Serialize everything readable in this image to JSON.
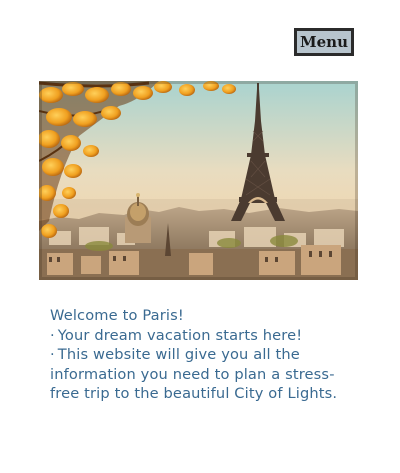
{
  "header": {
    "menu_label": "Menu"
  },
  "hero": {
    "image_subject": "eiffel-tower-autumn-photo"
  },
  "intro": {
    "welcome": "Welcome to Paris!",
    "bullet_glyph": "·",
    "bullets": [
      "Your dream vacation starts here!",
      "This website will give you all the information you need to plan a stress-free trip to the beautiful City of Lights."
    ]
  },
  "colors": {
    "text": "#3a6a91",
    "menu_background": "#b7c4cd",
    "menu_border": "#2b2b2b"
  }
}
